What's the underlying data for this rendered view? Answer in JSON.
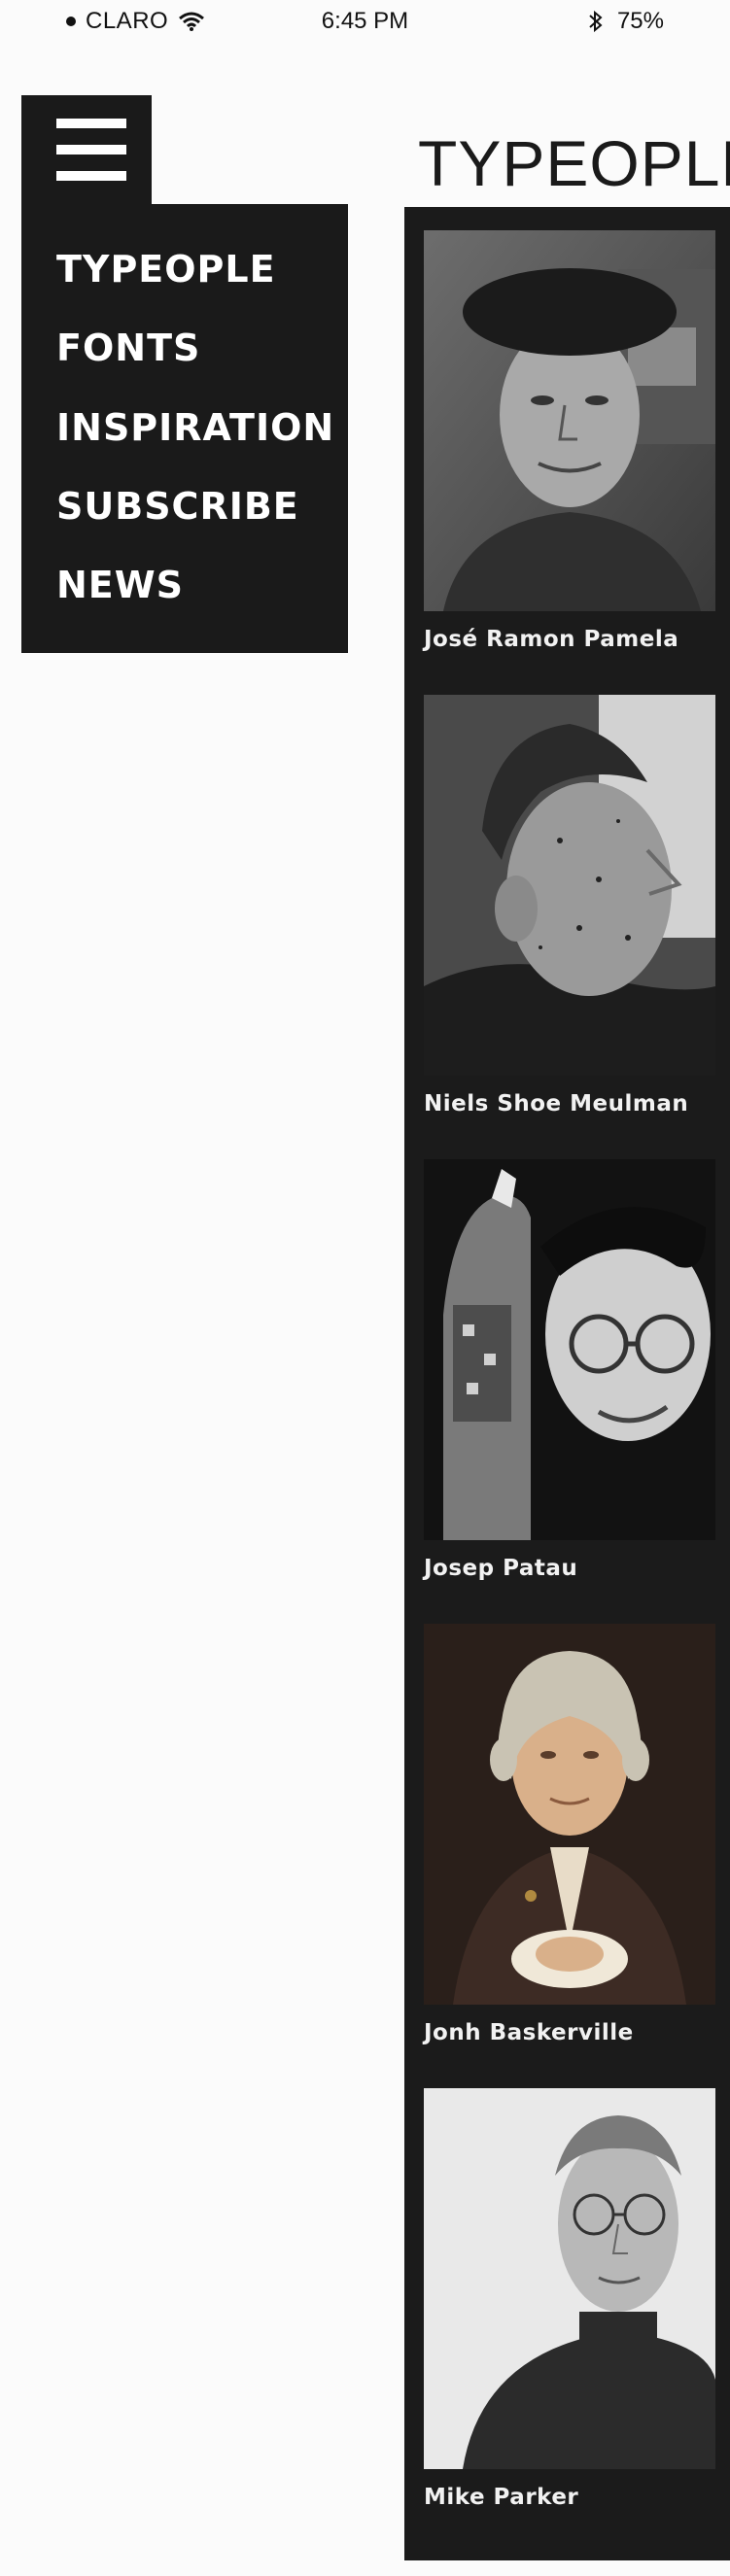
{
  "status_bar": {
    "carrier": "CLARO",
    "time": "6:45 PM",
    "battery": "75%"
  },
  "menu": {
    "items": [
      {
        "label": "TYPEOPLE"
      },
      {
        "label": "FONTS"
      },
      {
        "label": "INSPIRATION"
      },
      {
        "label": "SUBSCRIBE"
      },
      {
        "label": "NEWS"
      }
    ]
  },
  "page": {
    "title": "TYPEOPLE"
  },
  "people": [
    {
      "name": "José Ramon Pamela"
    },
    {
      "name": "Niels Shoe Meulman"
    },
    {
      "name": "Josep Patau"
    },
    {
      "name": "Jonh Baskerville"
    },
    {
      "name": "Mike Parker"
    }
  ]
}
